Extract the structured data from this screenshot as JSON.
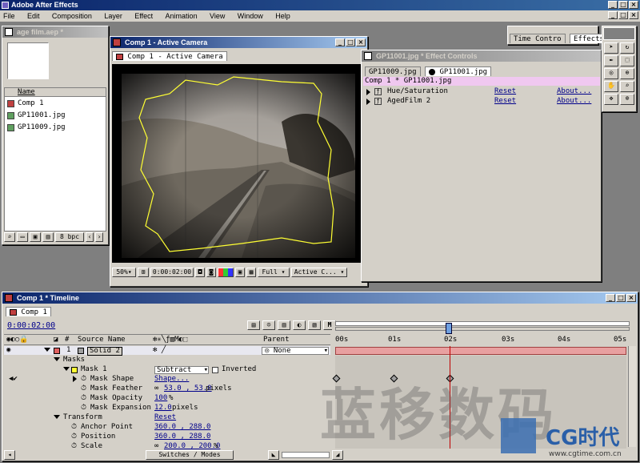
{
  "app": {
    "title": "Adobe After Effects",
    "menu": [
      "File",
      "Edit",
      "Composition",
      "Layer",
      "Effect",
      "Animation",
      "View",
      "Window",
      "Help"
    ]
  },
  "project": {
    "title": "age film.aep *",
    "column_name": "Name",
    "items": [
      {
        "label": "Comp 1",
        "icon": "composition-icon"
      },
      {
        "label": "GP11001.jpg",
        "icon": "image-file-icon"
      },
      {
        "label": "GP11009.jpg",
        "icon": "image-file-icon"
      }
    ],
    "bpc": "8 bpc"
  },
  "comp": {
    "title": "Comp 1 - Active Camera",
    "tab": "Comp 1 - Active Camera",
    "zoom": "50%",
    "timecode": "0:00:02:00",
    "resolution": "Full",
    "camera": "Active C..."
  },
  "palettes": {
    "tabs": [
      "Time Contro",
      "Effects"
    ]
  },
  "effect_controls": {
    "title": "GP11001.jpg * Effect Controls",
    "tabs": [
      "GP11009.jpg",
      "GP11001.jpg"
    ],
    "header": "Comp 1 * GP11001.jpg",
    "effects": [
      {
        "name": "Hue/Saturation",
        "reset": "Reset",
        "about": "About..."
      },
      {
        "name": "AgedFilm 2",
        "reset": "Reset",
        "about": "About..."
      }
    ]
  },
  "timeline": {
    "title": "Comp 1 * Timeline",
    "tab": "Comp 1",
    "timecode": "0:00:02:00",
    "columns": {
      "num": "#",
      "source": "Source Name",
      "parent": "Parent"
    },
    "ruler": [
      "00s",
      "01s",
      "02s",
      "03s",
      "04s",
      "05s"
    ],
    "layer": {
      "num": "1",
      "name": "Solid 2",
      "parent": "None"
    },
    "masks_label": "Masks",
    "mask": {
      "name": "Mask 1",
      "mode": "Subtract",
      "inverted": "Inverted"
    },
    "mask_props": [
      {
        "name": "Mask Shape",
        "value": "Shape..."
      },
      {
        "name": "Mask Feather",
        "value": "53.0 , 53.0",
        "unit": "pixels"
      },
      {
        "name": "Mask Opacity",
        "value": "100",
        "unit": "%"
      },
      {
        "name": "Mask Expansion",
        "value": "12.0",
        "unit": "pixels"
      }
    ],
    "transform_label": "Transform",
    "transform_reset": "Reset",
    "transform_props": [
      {
        "name": "Anchor Point",
        "value": "360.0 , 288.0"
      },
      {
        "name": "Position",
        "value": "360.0 , 288.0"
      },
      {
        "name": "Scale",
        "value": "200.0 , 200.0",
        "unit": "%"
      }
    ],
    "switches": "Switches / Modes"
  },
  "watermark": {
    "text": "蓝移数码",
    "brand": "CG时代",
    "url": "www.cgtime.com.cn"
  }
}
